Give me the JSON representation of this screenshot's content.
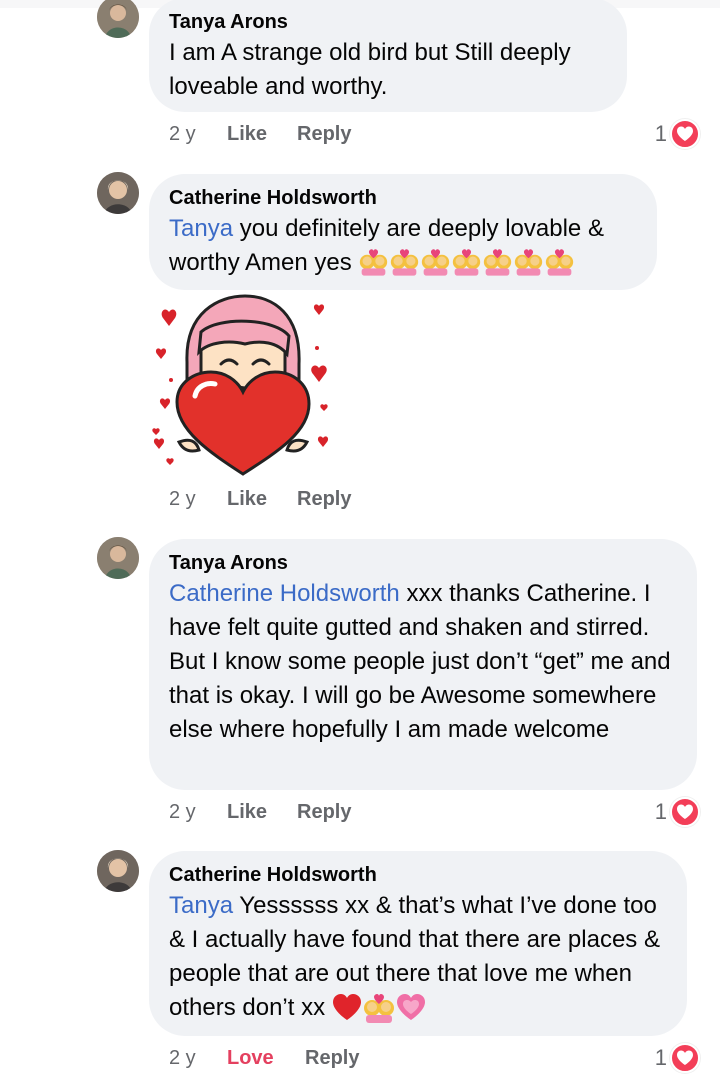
{
  "comments": [
    {
      "author": "Tanya Arons",
      "mention": "",
      "text": "I am A strange old bird but Still deeply loveable and worthy.",
      "actions": {
        "time": "2 y",
        "like": "Like",
        "reply": "Reply"
      },
      "reaction_count": "1"
    },
    {
      "author": "Catherine Holdsworth",
      "mention": "Tanya",
      "text": " you definitely are deeply lovable & worthy Amen yes",
      "actions": {
        "time": "2 y",
        "like": "Like",
        "reply": "Reply"
      },
      "reaction_count": "",
      "emoji_count": 7
    },
    {
      "author": "Tanya Arons",
      "mention": "Catherine Holdsworth",
      "text": " xxx thanks Catherine. I have felt quite gutted and shaken and stirred.  But I know some people just don’t “get” me and that is okay.  I will go be Awesome somewhere else where hopefully I am made welcome",
      "actions": {
        "time": "2 y",
        "like": "Like",
        "reply": "Reply"
      },
      "reaction_count": "1"
    },
    {
      "author": "Catherine Holdsworth",
      "mention": "Tanya",
      "text": "  Yessssss xx & that’s what I’ve done too & I actually have found that there are places & people that are out there that love me when others don’t xx",
      "actions": {
        "time": "2 y",
        "like": "Love",
        "reply": "Reply"
      },
      "reaction_count": "1"
    }
  ],
  "sticker_actions": {
    "time": "2 y",
    "like": "Like",
    "reply": "Reply"
  },
  "icons": {
    "reaction": "heart-reaction-icon",
    "emoji": "couple-with-heart-icon",
    "sticker": "girl-holding-heart-sticker"
  },
  "colors": {
    "mention": "#3b6bc7",
    "love": "#e4405f",
    "reaction_badge": "#f33e58",
    "bubble": "#f0f2f5"
  }
}
